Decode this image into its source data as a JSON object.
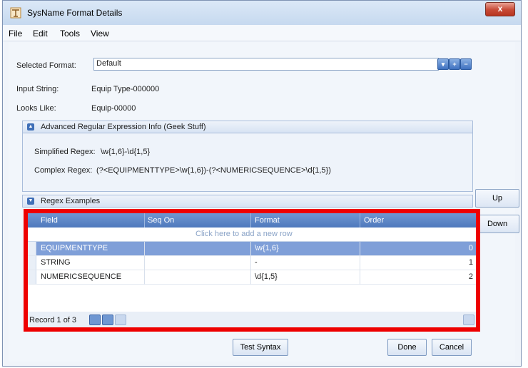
{
  "window": {
    "title": "SysName Format Details",
    "close_glyph": "x"
  },
  "menu": [
    "File",
    "Edit",
    "Tools",
    "View"
  ],
  "selected_format": {
    "label": "Selected Format:",
    "value": "Default"
  },
  "input_string": {
    "label": "Input String:",
    "value": "Equip Type-000000"
  },
  "looks_like": {
    "label": "Looks Like:",
    "value": "Equip-00000"
  },
  "advanced": {
    "title": "Advanced Regular Expression Info (Geek Stuff)",
    "simplified_label": "Simplified Regex:",
    "simplified_value": "\\w{1,6}-\\d{1,5}",
    "complex_label": "Complex Regex:",
    "complex_value": "(?<EQUIPMENTTYPE>\\w{1,6})-(?<NUMERICSEQUENCE>\\d{1,5})"
  },
  "examples": {
    "title": "Regex Examples"
  },
  "side_buttons": {
    "up": "Up",
    "down": "Down"
  },
  "grid": {
    "columns": [
      "Field",
      "Seq On",
      "Format",
      "Order"
    ],
    "new_row_text": "Click here to add a new row",
    "rows": [
      {
        "field": "EQUIPMENTTYPE",
        "seq_on": "",
        "format": "\\w{1,6}",
        "order": "0",
        "selected": true
      },
      {
        "field": "STRING",
        "seq_on": "",
        "format": "-",
        "order": "1",
        "selected": false
      },
      {
        "field": "NUMERICSEQUENCE",
        "seq_on": "",
        "format": "\\d{1,5}",
        "order": "2",
        "selected": false
      }
    ],
    "record_text": "Record 1 of 3"
  },
  "buttons": {
    "test_syntax": "Test Syntax",
    "done": "Done",
    "cancel": "Cancel"
  },
  "colors": {
    "highlight_border": "#ee0000",
    "selection": "#7f9fd8",
    "header": "#5b84c4"
  }
}
